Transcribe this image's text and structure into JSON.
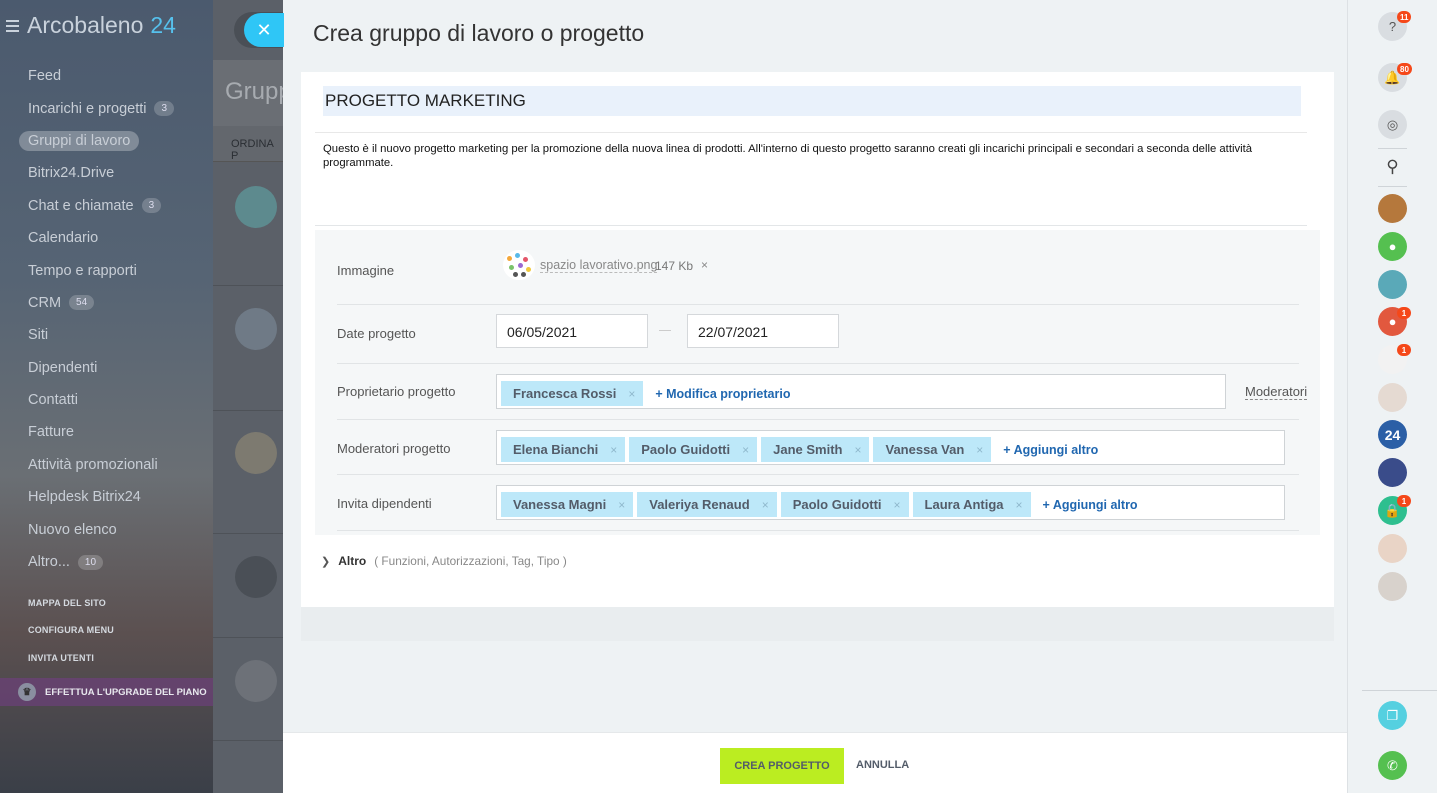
{
  "app": {
    "name": "Arcobaleno",
    "name_suffix": "24"
  },
  "sidebar": {
    "items": [
      {
        "label": "Feed",
        "count": null
      },
      {
        "label": "Incarichi e progetti",
        "count": "3"
      },
      {
        "label": "Gruppi di lavoro",
        "count": null,
        "active": true
      },
      {
        "label": "Bitrix24.Drive",
        "count": null
      },
      {
        "label": "Chat e chiamate",
        "count": "3"
      },
      {
        "label": "Calendario",
        "count": null
      },
      {
        "label": "Tempo e rapporti",
        "count": null
      },
      {
        "label": "CRM",
        "count": "54"
      },
      {
        "label": "Siti",
        "count": null
      },
      {
        "label": "Dipendenti",
        "count": null
      },
      {
        "label": "Contatti",
        "count": null
      },
      {
        "label": "Fatture",
        "count": null
      },
      {
        "label": "Attività promozionali",
        "count": null
      },
      {
        "label": "Helpdesk Bitrix24",
        "count": null
      },
      {
        "label": "Nuovo elenco",
        "count": null
      },
      {
        "label": "Altro...",
        "count": "10"
      }
    ],
    "links": [
      "MAPPA DEL SITO",
      "CONFIGURA MENU",
      "INVITA UTENTI"
    ],
    "upgrade": "EFFETTUA L'UPGRADE DEL PIANO"
  },
  "background": {
    "heading": "Grupp",
    "sort": "ORDINA P"
  },
  "slider": {
    "title": "Crea gruppo di lavoro o progetto",
    "project_name": "PROGETTO MARKETING",
    "description": "Questo è il nuovo progetto marketing per la promozione della nuova linea di prodotti. All'interno di questo progetto saranno creati gli incarichi principali e secondari a seconda delle attività programmate.",
    "image": {
      "label": "Immagine",
      "file_name": "spazio lavorativo.png",
      "file_size": "147 Kb",
      "remove": "×"
    },
    "dates": {
      "label": "Date progetto",
      "start": "06/05/2021",
      "end": "22/07/2021"
    },
    "owner": {
      "label": "Proprietario progetto",
      "tags": [
        "Francesca Rossi"
      ],
      "action": "+ Modifica proprietario",
      "moderators_link": "Moderatori"
    },
    "moderators": {
      "label": "Moderatori progetto",
      "tags": [
        "Elena Bianchi",
        "Paolo Guidotti",
        "Jane Smith",
        "Vanessa Van"
      ],
      "action": "+ Aggiungi altro"
    },
    "invite": {
      "label": "Invita dipendenti",
      "tags": [
        "Vanessa Magni",
        "Valeriya Renaud",
        "Paolo Guidotti",
        "Laura Antiga"
      ],
      "action": "+ Aggiungi altro"
    },
    "more": {
      "label": "Altro",
      "details": "( Funzioni,   Autorizzazioni,  Tag,   Tipo   )"
    },
    "buttons": {
      "create": "CREA PROGETTO",
      "cancel": "ANNULLA"
    }
  },
  "rightbar": {
    "help_badge": "11",
    "notifications_badge": "80",
    "user_badges": [
      "1",
      "1",
      "1"
    ],
    "chat24_label": "24"
  },
  "colors": {
    "accent": "#2fc6f6",
    "create_button": "#bbed21",
    "tag_bg": "#bde8f9",
    "badge": "#f54819"
  }
}
